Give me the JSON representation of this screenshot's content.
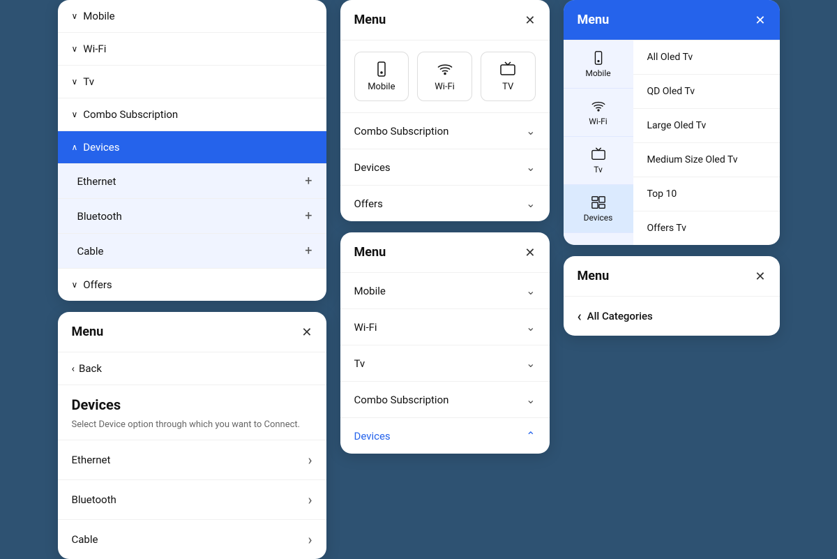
{
  "col1": {
    "card1": {
      "nav_items": [
        {
          "label": "Mobile",
          "arrow": "down",
          "active": false,
          "sub": false
        },
        {
          "label": "Wi-Fi",
          "arrow": "down",
          "active": false,
          "sub": false
        },
        {
          "label": "Tv",
          "arrow": "down",
          "active": false,
          "sub": false
        },
        {
          "label": "Combo Subscription",
          "arrow": "down",
          "active": false,
          "sub": false
        },
        {
          "label": "Devices",
          "arrow": "up",
          "active": true,
          "sub": false
        }
      ],
      "sub_items": [
        {
          "label": "Ethernet"
        },
        {
          "label": "Bluetooth"
        },
        {
          "label": "Cable"
        }
      ],
      "footer_item": {
        "label": "Offers",
        "arrow": "down"
      }
    },
    "card2": {
      "title": "Menu",
      "back_label": "Back",
      "section_title": "Devices",
      "section_desc": "Select Device option through which you want to Connect.",
      "sub_items": [
        {
          "label": "Ethernet"
        },
        {
          "label": "Bluetooth"
        },
        {
          "label": "Cable"
        }
      ]
    }
  },
  "col2": {
    "card1": {
      "title": "Menu",
      "icon_tabs": [
        {
          "label": "Mobile",
          "icon": "mobile"
        },
        {
          "label": "Wi-Fi",
          "icon": "wifi"
        },
        {
          "label": "TV",
          "icon": "tv"
        }
      ],
      "accordion_items": [
        {
          "label": "Combo Subscription",
          "state": "down"
        },
        {
          "label": "Devices",
          "state": "down"
        },
        {
          "label": "Offers",
          "state": "down"
        }
      ]
    },
    "card2": {
      "title": "Menu",
      "accordion_items": [
        {
          "label": "Mobile",
          "state": "down",
          "active": false
        },
        {
          "label": "Wi-Fi",
          "state": "down",
          "active": false
        },
        {
          "label": "Tv",
          "state": "down",
          "active": false
        },
        {
          "label": "Combo Subscription",
          "state": "down",
          "active": false
        },
        {
          "label": "Devices",
          "state": "up",
          "active": true
        }
      ]
    }
  },
  "col3": {
    "card1": {
      "title": "Menu",
      "blue_header": true,
      "left_nav": [
        {
          "label": "Mobile",
          "icon": "mobile",
          "active": false
        },
        {
          "label": "Wi-Fi",
          "icon": "wifi",
          "active": false
        },
        {
          "label": "Tv",
          "icon": "tv",
          "active": false
        },
        {
          "label": "Devices",
          "icon": "devices",
          "active": true
        }
      ],
      "right_items_top": [
        {
          "label": "All Oled Tv"
        },
        {
          "label": "QD Oled Tv"
        },
        {
          "label": "Large Oled Tv"
        },
        {
          "label": "Medium Size Oled Tv"
        }
      ],
      "right_items_bottom": [
        {
          "label": "Top 10"
        },
        {
          "label": "Offers Tv"
        }
      ]
    },
    "card2": {
      "title": "Menu",
      "all_cat_label": "All Categories"
    }
  },
  "icons": {
    "close": "✕",
    "chevron_down": "∨",
    "chevron_up": "∧",
    "chevron_right": "›",
    "chevron_left": "‹",
    "plus": "+"
  }
}
